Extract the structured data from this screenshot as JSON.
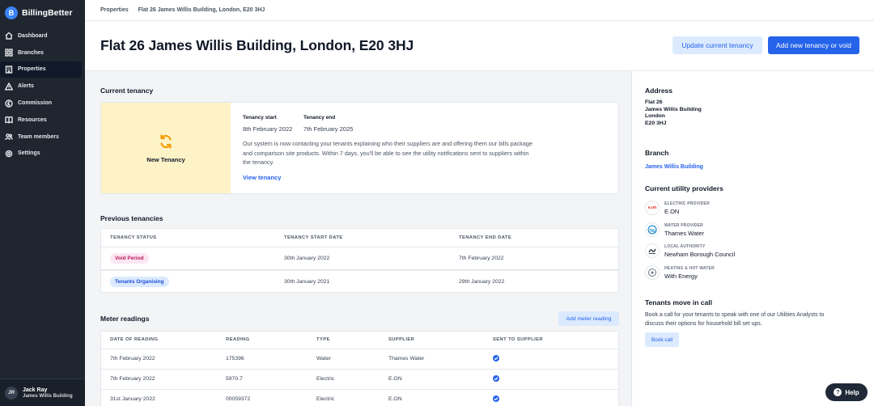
{
  "brand": {
    "logo_letter": "B",
    "name": "BillingBetter"
  },
  "sidebar": {
    "items": [
      {
        "label": "Dashboard",
        "icon": "home-icon"
      },
      {
        "label": "Branches",
        "icon": "grid-icon"
      },
      {
        "label": "Properties",
        "icon": "building-icon",
        "active": true
      },
      {
        "label": "Alerts",
        "icon": "alert-icon"
      },
      {
        "label": "Commission",
        "icon": "currency-icon"
      },
      {
        "label": "Resources",
        "icon": "book-icon"
      },
      {
        "label": "Team members",
        "icon": "users-icon"
      },
      {
        "label": "Settings",
        "icon": "gear-icon"
      }
    ],
    "user": {
      "initials": "JR",
      "name": "Jack Ray",
      "branch": "James Willis Building"
    }
  },
  "breadcrumb": {
    "root": "Properties",
    "current": "Flat 26 James Willis Building, London, E20 3HJ"
  },
  "header": {
    "title": "Flat 26 James Willis Building, London, E20 3HJ",
    "update_button": "Update current tenancy",
    "add_button": "Add new tenancy or void"
  },
  "current_tenancy": {
    "title": "Current tenancy",
    "badge": "New Tenancy",
    "start_label": "Tenancy start",
    "start_value": "8th February 2022",
    "end_label": "Tenancy end",
    "end_value": "7th February 2025",
    "description": "Our system is now contacting your tenants explaining who their suppliers are and offering them our bills package and comparison site products. Within 7 days, you'll be able to see the utility notifications sent to suppliers within the tenancy.",
    "view_link": "View tenancy"
  },
  "previous_tenancies": {
    "title": "Previous tenancies",
    "columns": [
      "TENANCY STATUS",
      "TENANCY START DATE",
      "TENANCY END DATE"
    ],
    "rows": [
      {
        "status": "Void Period",
        "start": "30th January 2022",
        "end": "7th February 2022"
      },
      {
        "status": "Tenants Organising",
        "start": "30th January 2021",
        "end": "29th January 2022"
      }
    ]
  },
  "meter_readings": {
    "title": "Meter readings",
    "add_button": "Add meter reading",
    "columns": [
      "DATE OF READING",
      "READING",
      "TYPE",
      "SUPPLIER",
      "SENT TO SUPPLIER"
    ],
    "rows": [
      {
        "date": "7th February 2022",
        "reading": "175396",
        "type": "Water",
        "supplier": "Thames Water",
        "sent": true
      },
      {
        "date": "7th February 2022",
        "reading": "5970.7",
        "type": "Electric",
        "supplier": "E.ON",
        "sent": true
      },
      {
        "date": "31st January 2022",
        "reading": "00059372",
        "type": "Electric",
        "supplier": "E.ON",
        "sent": true
      }
    ]
  },
  "right": {
    "address_title": "Address",
    "address_lines": [
      "Flat 26",
      "James Willis Building",
      "London",
      "E20 3HJ"
    ],
    "branch_title": "Branch",
    "branch_link": "James Willis Building",
    "providers_title": "Current utility providers",
    "providers": [
      {
        "category": "ELECTRIC PROVIDER",
        "name": "E.ON",
        "logo_text": "e.on",
        "color": "#e2231a"
      },
      {
        "category": "WATER PROVIDER",
        "name": "Thames Water",
        "logo_text": "",
        "color": "#0079c1"
      },
      {
        "category": "LOCAL AUTHORITY",
        "name": "Newham Borough Council",
        "logo_text": "",
        "color": "#111827"
      },
      {
        "category": "HEATING & HOT WATER",
        "name": "With Energy",
        "logo_text": "",
        "color": "#6b7280"
      }
    ],
    "call_title": "Tenants move in call",
    "call_desc": "Book a call for your tenants to speak with one of our Utilities Analysts to discuss their options for household bill set ups.",
    "call_button": "Book call"
  },
  "help": {
    "label": "Help",
    "glyph": "?"
  }
}
